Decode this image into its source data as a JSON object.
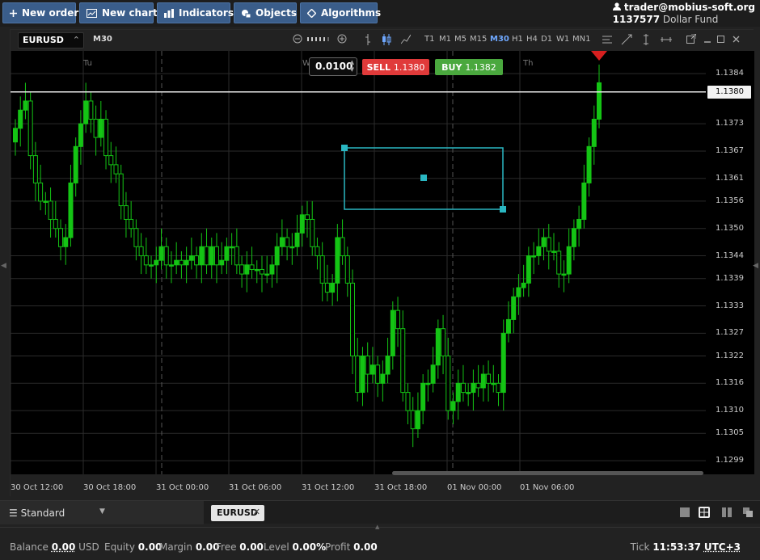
{
  "toolbar": {
    "new_order": "New order",
    "new_chart": "New chart",
    "indicators": "Indicators",
    "objects": "Objects",
    "algorithms": "Algorithms"
  },
  "account": {
    "user": "trader@mobius-soft.org",
    "number": "1137577",
    "name": "Dollar Fund"
  },
  "chart": {
    "symbol": "EURUSD",
    "timeframe": "M30",
    "timeframes": [
      "T1",
      "M1",
      "M5",
      "M15",
      "M30",
      "H1",
      "H4",
      "D1",
      "W1",
      "MN1"
    ],
    "active_timeframe": "M30",
    "quantity": "0.0100",
    "sell_label": "SELL",
    "sell_price": "1.1380",
    "buy_label": "BUY",
    "buy_price": "1.1382",
    "current_price": "1.1380",
    "day_labels": [
      "Tu",
      "W",
      "Th"
    ],
    "colors": {
      "bull": "#14c414",
      "bear": "#14c414",
      "rect": "#2ab7c2",
      "sell": "#e03a3a",
      "buy": "#4aa83e"
    }
  },
  "chart_data": {
    "type": "candlestick",
    "symbol": "EURUSD",
    "timeframe": "M30",
    "y_ticks": [
      "1.1384",
      "1.1380",
      "1.1373",
      "1.1367",
      "1.1361",
      "1.1356",
      "1.1350",
      "1.1344",
      "1.1339",
      "1.1333",
      "1.1327",
      "1.1322",
      "1.1316",
      "1.1310",
      "1.1305",
      "1.1299"
    ],
    "x_ticks": [
      "30 Oct 12:00",
      "30 Oct 18:00",
      "31 Oct 00:00",
      "31 Oct 06:00",
      "31 Oct 12:00",
      "31 Oct 18:00",
      "01 Nov 00:00",
      "01 Nov 06:00"
    ],
    "ylim": [
      1.1296,
      1.1389
    ],
    "last_price": 1.138,
    "closes": [
      1.1372,
      1.1376,
      1.1378,
      1.1366,
      1.136,
      1.1356,
      1.1356,
      1.1352,
      1.135,
      1.1346,
      1.1348,
      1.136,
      1.1368,
      1.1373,
      1.1378,
      1.1374,
      1.137,
      1.1374,
      1.1366,
      1.1364,
      1.1362,
      1.1355,
      1.1352,
      1.135,
      1.1346,
      1.1344,
      1.1342,
      1.1342,
      1.1343,
      1.1346,
      1.1342,
      1.1342,
      1.1343,
      1.1342,
      1.1343,
      1.1344,
      1.1342,
      1.1346,
      1.1342,
      1.1346,
      1.1342,
      1.1343,
      1.1346,
      1.1346,
      1.1342,
      1.134,
      1.1342,
      1.1341,
      1.1341,
      1.134,
      1.134,
      1.1342,
      1.1346,
      1.1348,
      1.1346,
      1.1346,
      1.1349,
      1.1353,
      1.1352,
      1.1346,
      1.1344,
      1.1338,
      1.1336,
      1.1338,
      1.1348,
      1.1344,
      1.1338,
      1.1322,
      1.1314,
      1.1322,
      1.1318,
      1.132,
      1.1316,
      1.1318,
      1.1322,
      1.1332,
      1.1328,
      1.1314,
      1.131,
      1.1306,
      1.131,
      1.1316,
      1.1316,
      1.132,
      1.1328,
      1.1322,
      1.131,
      1.1312,
      1.1316,
      1.1314,
      1.1314,
      1.1316,
      1.1315,
      1.1318,
      1.1316,
      1.1316,
      1.1314,
      1.1327,
      1.133,
      1.1335,
      1.1337,
      1.1338,
      1.1344,
      1.1344,
      1.1346,
      1.1348,
      1.1345,
      1.1345,
      1.134,
      1.134,
      1.1346,
      1.135,
      1.1352,
      1.136,
      1.1368,
      1.1374,
      1.1382
    ]
  },
  "tabs": {
    "layout": "Standard",
    "symbol_tab": "EURUSD"
  },
  "status": {
    "balance_label": "Balance",
    "balance_value": "0.00",
    "currency": "USD",
    "equity_label": "Equity",
    "equity_value": "0.00",
    "margin_label": "Margin",
    "margin_value": "0.00",
    "free_label": "Free",
    "free_value": "0.00",
    "level_label": "Level",
    "level_value": "0.00%",
    "profit_label": "Profit",
    "profit_value": "0.00",
    "tick_label": "Tick",
    "time": "11:53:37",
    "timezone": "UTC+3"
  }
}
